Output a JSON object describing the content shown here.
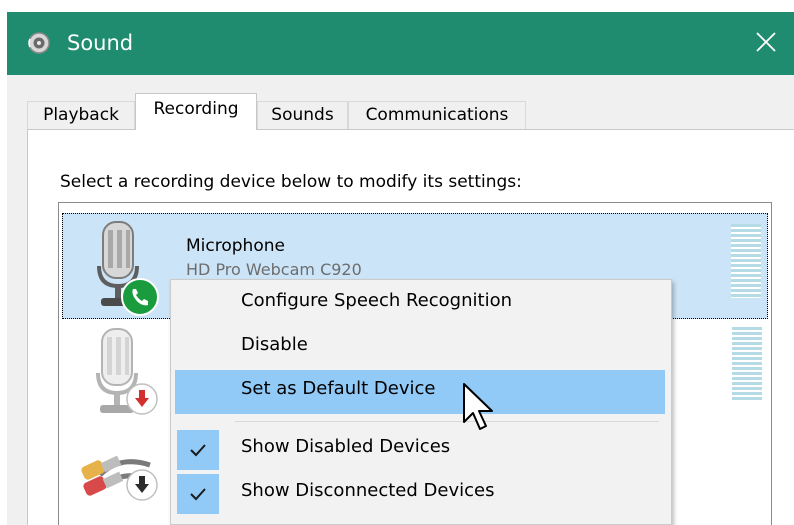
{
  "window": {
    "title": "Sound",
    "title_icon": "speaker-icon",
    "close_icon": "close-icon",
    "titlebar_color": "#1f8c6f"
  },
  "tabs": [
    {
      "label": "Playback",
      "active": false
    },
    {
      "label": "Recording",
      "active": true
    },
    {
      "label": "Sounds",
      "active": false
    },
    {
      "label": "Communications",
      "active": false
    }
  ],
  "panel": {
    "instruction": "Select a recording device below to modify its settings:"
  },
  "devices": [
    {
      "name": "Microphone",
      "description": "HD Pro Webcam C920",
      "status": "default",
      "status_icon": "phone-icon",
      "selected": true
    },
    {
      "name": "",
      "description": "",
      "status": "disabled",
      "status_icon": "arrow-down-icon",
      "selected": false
    },
    {
      "name": "",
      "description": "",
      "status": "disconnected",
      "status_icon": "arrow-down-icon",
      "selected": false
    }
  ],
  "context_menu": {
    "items": [
      {
        "label": "Configure Speech Recognition",
        "checked": false,
        "highlighted": false
      },
      {
        "label": "Disable",
        "checked": false,
        "highlighted": false
      },
      {
        "label": "Set as Default Device",
        "checked": false,
        "highlighted": true
      },
      {
        "label": "Show Disabled Devices",
        "checked": true,
        "highlighted": false
      },
      {
        "label": "Show Disconnected Devices",
        "checked": true,
        "highlighted": false
      }
    ]
  },
  "colors": {
    "selection": "#cce4f7",
    "menu_highlight": "#91c9f7",
    "default_badge": "#1a9c3e",
    "disabled_badge": "#d32f2f"
  }
}
